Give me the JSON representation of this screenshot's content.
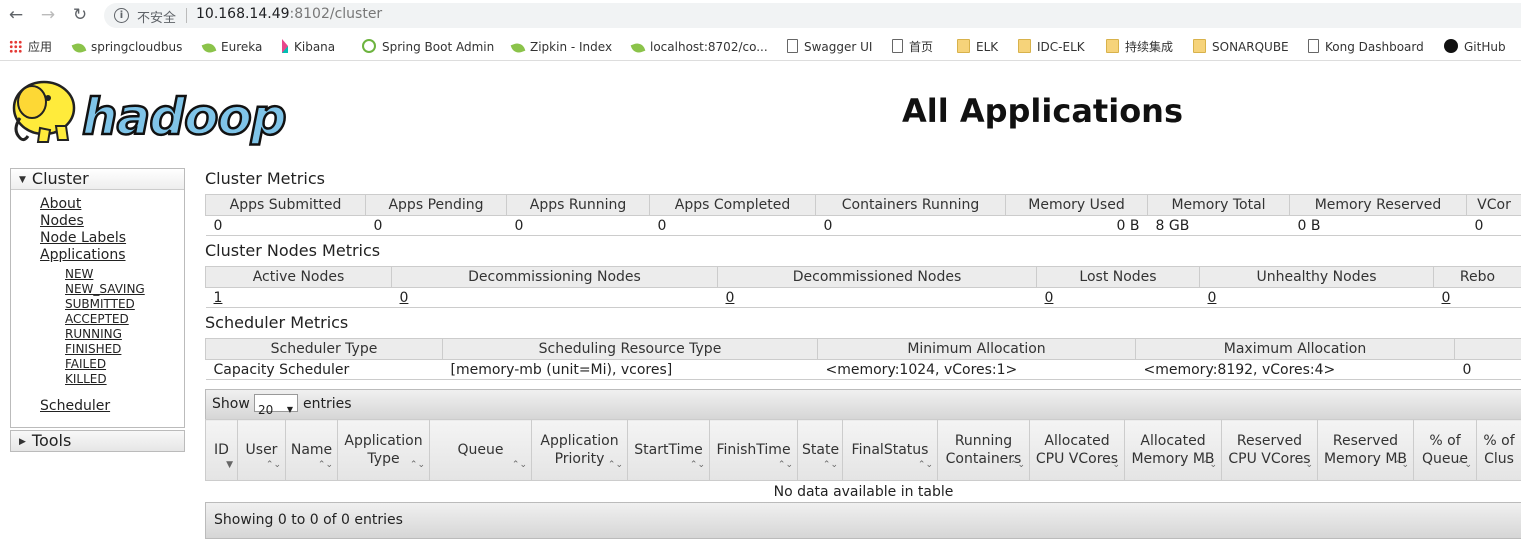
{
  "browser": {
    "insecure_label": "不安全",
    "url_host": "10.168.14.49",
    "url_path": ":8102/cluster",
    "bookmarks": [
      {
        "label": "应用",
        "icon": "apps-grid-icon"
      },
      {
        "label": "springcloudbus",
        "icon": "leaf-icon"
      },
      {
        "label": "Eureka",
        "icon": "leaf-icon"
      },
      {
        "label": "Kibana",
        "icon": "kibana-icon"
      },
      {
        "label": "Spring Boot Admin",
        "icon": "spring-boot-icon"
      },
      {
        "label": "Zipkin - Index",
        "icon": "leaf-icon"
      },
      {
        "label": "localhost:8702/co...",
        "icon": "leaf-icon"
      },
      {
        "label": "Swagger UI",
        "icon": "document-icon"
      },
      {
        "label": "首页",
        "icon": "document-icon"
      },
      {
        "label": "ELK",
        "icon": "folder-icon"
      },
      {
        "label": "IDC-ELK",
        "icon": "folder-icon"
      },
      {
        "label": "持续集成",
        "icon": "folder-icon"
      },
      {
        "label": "SONARQUBE",
        "icon": "folder-icon"
      },
      {
        "label": "Kong Dashboard",
        "icon": "document-icon"
      },
      {
        "label": "GitHub",
        "icon": "github-icon"
      }
    ]
  },
  "header": {
    "logo_text": "hadoop",
    "title": "All Applications"
  },
  "sidebar": {
    "cluster_label": "Cluster",
    "links": [
      "About",
      "Nodes",
      "Node Labels",
      "Applications"
    ],
    "app_states": [
      "NEW",
      "NEW_SAVING",
      "SUBMITTED",
      "ACCEPTED",
      "RUNNING",
      "FINISHED",
      "FAILED",
      "KILLED"
    ],
    "scheduler_label": "Scheduler",
    "tools_label": "Tools"
  },
  "cluster_metrics": {
    "title": "Cluster Metrics",
    "headers": [
      "Apps Submitted",
      "Apps Pending",
      "Apps Running",
      "Apps Completed",
      "Containers Running",
      "Memory Used",
      "Memory Total",
      "Memory Reserved",
      "VCor"
    ],
    "values": [
      "0",
      "0",
      "0",
      "0",
      "0",
      "0 B",
      "8 GB",
      "0 B",
      "0"
    ]
  },
  "node_metrics": {
    "title": "Cluster Nodes Metrics",
    "headers": [
      "Active Nodes",
      "Decommissioning Nodes",
      "Decommissioned Nodes",
      "Lost Nodes",
      "Unhealthy Nodes",
      "Rebo"
    ],
    "values": [
      "1",
      "0",
      "0",
      "0",
      "0",
      "0"
    ]
  },
  "scheduler_metrics": {
    "title": "Scheduler Metrics",
    "headers": [
      "Scheduler Type",
      "Scheduling Resource Type",
      "Minimum Allocation",
      "Maximum Allocation",
      ""
    ],
    "values": [
      "Capacity Scheduler",
      "[memory-mb (unit=Mi), vcores]",
      "<memory:1024, vCores:1>",
      "<memory:8192, vCores:4>",
      "0"
    ]
  },
  "apps_table": {
    "show_label": "Show",
    "page_size": "20",
    "entries_label": "entries",
    "headers": [
      "ID",
      "User",
      "Name",
      "Application Type",
      "Queue",
      "Application Priority",
      "StartTime",
      "FinishTime",
      "State",
      "FinalStatus",
      "Running Containers",
      "Allocated CPU VCores",
      "Allocated Memory MB",
      "Reserved CPU VCores",
      "Reserved Memory MB",
      "% of Queue",
      "% of Clus"
    ],
    "empty_message": "No data available in table",
    "footer": "Showing 0 to 0 of 0 entries"
  }
}
